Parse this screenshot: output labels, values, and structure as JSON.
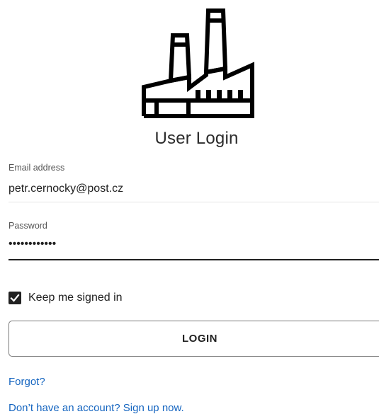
{
  "logo": {
    "icon": "factory-icon"
  },
  "title": "User Login",
  "email": {
    "label": "Email address",
    "value": "petr.cernocky@post.cz"
  },
  "password": {
    "label": "Password",
    "value": "••••••••••••"
  },
  "remember": {
    "checked": true,
    "label": "Keep me signed in"
  },
  "login_button": {
    "label": "LOGIN"
  },
  "links": {
    "forgot": "Forgot?",
    "signup": "Don’t have an account? Sign up now."
  },
  "colors": {
    "text": "#212121",
    "link": "#1565c0",
    "checkbox": "#212121"
  }
}
